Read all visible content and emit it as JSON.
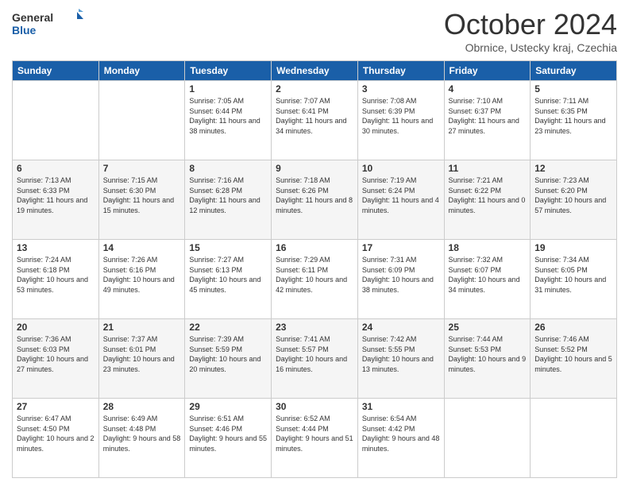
{
  "header": {
    "logo_general": "General",
    "logo_blue": "Blue",
    "title": "October 2024",
    "location": "Obrnice, Ustecky kraj, Czechia"
  },
  "days_of_week": [
    "Sunday",
    "Monday",
    "Tuesday",
    "Wednesday",
    "Thursday",
    "Friday",
    "Saturday"
  ],
  "weeks": [
    [
      {
        "day": "",
        "info": ""
      },
      {
        "day": "",
        "info": ""
      },
      {
        "day": "1",
        "info": "Sunrise: 7:05 AM\nSunset: 6:44 PM\nDaylight: 11 hours and 38 minutes."
      },
      {
        "day": "2",
        "info": "Sunrise: 7:07 AM\nSunset: 6:41 PM\nDaylight: 11 hours and 34 minutes."
      },
      {
        "day": "3",
        "info": "Sunrise: 7:08 AM\nSunset: 6:39 PM\nDaylight: 11 hours and 30 minutes."
      },
      {
        "day": "4",
        "info": "Sunrise: 7:10 AM\nSunset: 6:37 PM\nDaylight: 11 hours and 27 minutes."
      },
      {
        "day": "5",
        "info": "Sunrise: 7:11 AM\nSunset: 6:35 PM\nDaylight: 11 hours and 23 minutes."
      }
    ],
    [
      {
        "day": "6",
        "info": "Sunrise: 7:13 AM\nSunset: 6:33 PM\nDaylight: 11 hours and 19 minutes."
      },
      {
        "day": "7",
        "info": "Sunrise: 7:15 AM\nSunset: 6:30 PM\nDaylight: 11 hours and 15 minutes."
      },
      {
        "day": "8",
        "info": "Sunrise: 7:16 AM\nSunset: 6:28 PM\nDaylight: 11 hours and 12 minutes."
      },
      {
        "day": "9",
        "info": "Sunrise: 7:18 AM\nSunset: 6:26 PM\nDaylight: 11 hours and 8 minutes."
      },
      {
        "day": "10",
        "info": "Sunrise: 7:19 AM\nSunset: 6:24 PM\nDaylight: 11 hours and 4 minutes."
      },
      {
        "day": "11",
        "info": "Sunrise: 7:21 AM\nSunset: 6:22 PM\nDaylight: 11 hours and 0 minutes."
      },
      {
        "day": "12",
        "info": "Sunrise: 7:23 AM\nSunset: 6:20 PM\nDaylight: 10 hours and 57 minutes."
      }
    ],
    [
      {
        "day": "13",
        "info": "Sunrise: 7:24 AM\nSunset: 6:18 PM\nDaylight: 10 hours and 53 minutes."
      },
      {
        "day": "14",
        "info": "Sunrise: 7:26 AM\nSunset: 6:16 PM\nDaylight: 10 hours and 49 minutes."
      },
      {
        "day": "15",
        "info": "Sunrise: 7:27 AM\nSunset: 6:13 PM\nDaylight: 10 hours and 45 minutes."
      },
      {
        "day": "16",
        "info": "Sunrise: 7:29 AM\nSunset: 6:11 PM\nDaylight: 10 hours and 42 minutes."
      },
      {
        "day": "17",
        "info": "Sunrise: 7:31 AM\nSunset: 6:09 PM\nDaylight: 10 hours and 38 minutes."
      },
      {
        "day": "18",
        "info": "Sunrise: 7:32 AM\nSunset: 6:07 PM\nDaylight: 10 hours and 34 minutes."
      },
      {
        "day": "19",
        "info": "Sunrise: 7:34 AM\nSunset: 6:05 PM\nDaylight: 10 hours and 31 minutes."
      }
    ],
    [
      {
        "day": "20",
        "info": "Sunrise: 7:36 AM\nSunset: 6:03 PM\nDaylight: 10 hours and 27 minutes."
      },
      {
        "day": "21",
        "info": "Sunrise: 7:37 AM\nSunset: 6:01 PM\nDaylight: 10 hours and 23 minutes."
      },
      {
        "day": "22",
        "info": "Sunrise: 7:39 AM\nSunset: 5:59 PM\nDaylight: 10 hours and 20 minutes."
      },
      {
        "day": "23",
        "info": "Sunrise: 7:41 AM\nSunset: 5:57 PM\nDaylight: 10 hours and 16 minutes."
      },
      {
        "day": "24",
        "info": "Sunrise: 7:42 AM\nSunset: 5:55 PM\nDaylight: 10 hours and 13 minutes."
      },
      {
        "day": "25",
        "info": "Sunrise: 7:44 AM\nSunset: 5:53 PM\nDaylight: 10 hours and 9 minutes."
      },
      {
        "day": "26",
        "info": "Sunrise: 7:46 AM\nSunset: 5:52 PM\nDaylight: 10 hours and 5 minutes."
      }
    ],
    [
      {
        "day": "27",
        "info": "Sunrise: 6:47 AM\nSunset: 4:50 PM\nDaylight: 10 hours and 2 minutes."
      },
      {
        "day": "28",
        "info": "Sunrise: 6:49 AM\nSunset: 4:48 PM\nDaylight: 9 hours and 58 minutes."
      },
      {
        "day": "29",
        "info": "Sunrise: 6:51 AM\nSunset: 4:46 PM\nDaylight: 9 hours and 55 minutes."
      },
      {
        "day": "30",
        "info": "Sunrise: 6:52 AM\nSunset: 4:44 PM\nDaylight: 9 hours and 51 minutes."
      },
      {
        "day": "31",
        "info": "Sunrise: 6:54 AM\nSunset: 4:42 PM\nDaylight: 9 hours and 48 minutes."
      },
      {
        "day": "",
        "info": ""
      },
      {
        "day": "",
        "info": ""
      }
    ]
  ]
}
